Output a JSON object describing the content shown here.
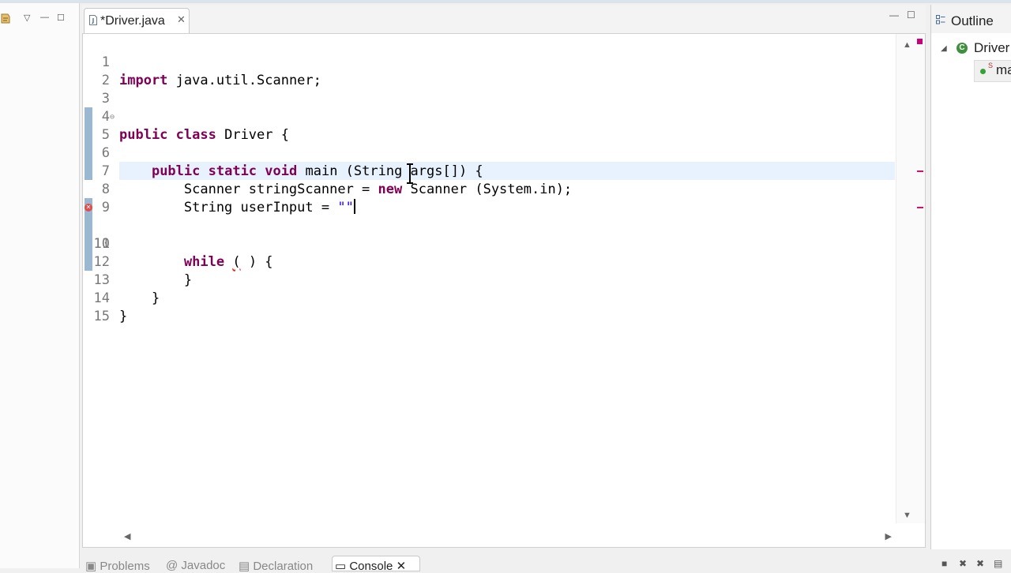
{
  "editor": {
    "tab_label": "*Driver.java",
    "minimize_glyph": "—",
    "maximize_glyph": "☐",
    "lines": [
      {
        "num": "1",
        "text": "import java.util.Scanner;"
      },
      {
        "num": "2",
        "text": ""
      },
      {
        "num": "3",
        "text": ""
      },
      {
        "num": "4",
        "text": "public class Driver {"
      },
      {
        "num": "5",
        "text": "    public static void main (String args[]) {"
      },
      {
        "num": "6",
        "text": ""
      },
      {
        "num": "7",
        "text": "        Scanner stringScanner = new Scanner (System.in);"
      },
      {
        "num": "8",
        "text": "        String userInput = \"\""
      },
      {
        "num": "9",
        "text": ""
      },
      {
        "num": "10",
        "text": "        while ( ) {"
      },
      {
        "num": "11",
        "text": ""
      },
      {
        "num": "12",
        "text": "        }"
      },
      {
        "num": "13",
        "text": "    }"
      },
      {
        "num": "14",
        "text": "}"
      },
      {
        "num": "15",
        "text": ""
      }
    ]
  },
  "outline": {
    "title": "Outline",
    "class_name": "Driver",
    "method_name": "ma"
  },
  "bottom_tabs": [
    {
      "label": "Problems"
    },
    {
      "label": "Javadoc"
    },
    {
      "label": "Declaration"
    },
    {
      "label": "Console"
    }
  ],
  "colors": {
    "keyword": "#7f0055",
    "string": "#2a00ff",
    "current_line": "#e8f2fe",
    "change_bar": "#9bb8d2",
    "error": "#e34b4b"
  }
}
